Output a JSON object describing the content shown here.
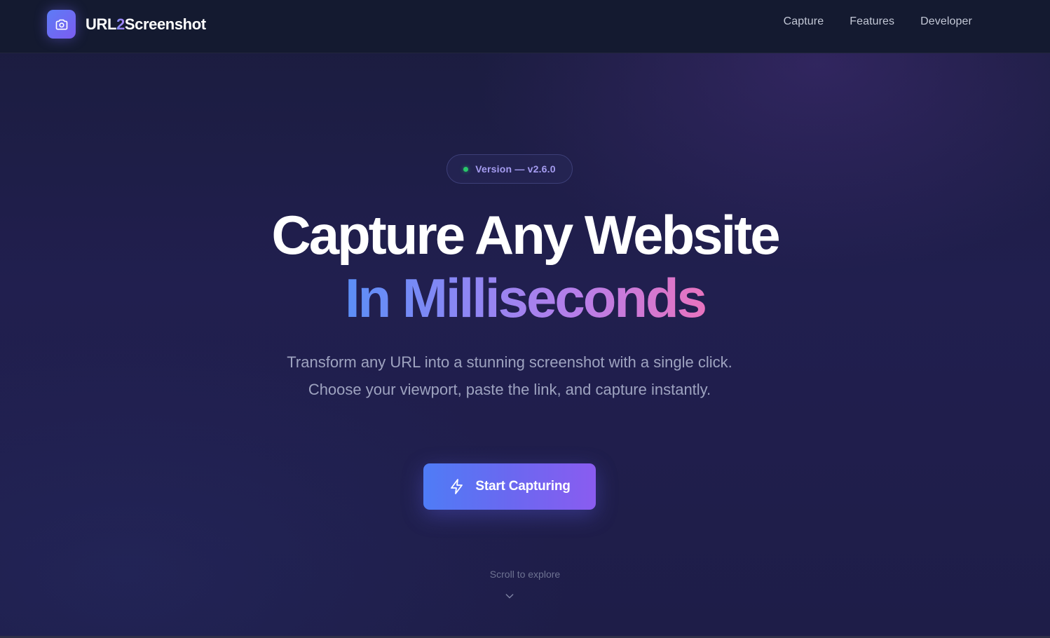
{
  "header": {
    "brand_prefix": "URL",
    "brand_accent": "2",
    "brand_suffix": "Screenshot",
    "logo_icon": "camera-icon",
    "nav": [
      {
        "label": "Capture"
      },
      {
        "label": "Features"
      },
      {
        "label": "Developer"
      }
    ]
  },
  "hero": {
    "version_badge": "Version — v2.6.0",
    "headline_line1": "Capture Any Website",
    "headline_line2": "In Milliseconds",
    "subtitle": "Transform any URL into a stunning screenshot with a single click. Choose your viewport, paste the link, and capture instantly.",
    "cta_label": "Start Capturing",
    "cta_icon": "lightning-icon",
    "scroll_hint": "Scroll to explore",
    "scroll_icon": "chevron-down-icon"
  },
  "colors": {
    "background": "#1e1d48",
    "navbar": "#141a30",
    "accent_blue": "#4f7cf6",
    "accent_purple": "#8a5cf0",
    "accent_pink": "#e873bf",
    "status_green": "#29c76a",
    "muted_text": "#9ea3c0"
  }
}
